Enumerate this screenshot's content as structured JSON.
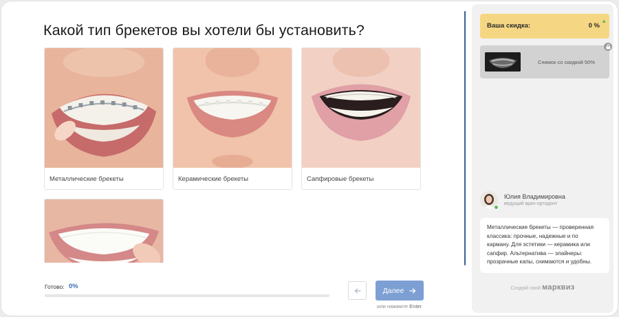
{
  "question": "Какой тип брекетов вы хотели бы установить?",
  "options": [
    {
      "label": "Металлические брекеты"
    },
    {
      "label": "Керамические брекеты"
    },
    {
      "label": "Сапфировые брекеты"
    },
    {
      "label": ""
    }
  ],
  "progress": {
    "label": "Готово:",
    "value": "0%",
    "percent": 0
  },
  "nav": {
    "back_icon": "arrow-left-icon",
    "next_label": "Далее",
    "next_icon": "arrow-right-icon",
    "hint_prefix": "или нажмите",
    "hint_key": "Enter"
  },
  "sidebar": {
    "discount": {
      "label": "Ваша скидка:",
      "value": "0 %"
    },
    "bonus": {
      "text": "Снимок со скидкой 50%",
      "icon": "lock-icon"
    },
    "consultant": {
      "name": "Юлия Владимировна",
      "role": "ведущий врач-ортодонт",
      "message": "Металлические брекеты — проверенная классика: прочные, надежные и по карману. Для эстетики — керамика или сапфир. Альтернатива — элайнеры: прозрачные капы, снимаются и удобны."
    },
    "footer": {
      "prefix": "Создай свой",
      "brand": "марквиз"
    }
  },
  "colors": {
    "accent": "#7d9fd4",
    "discount_bg": "#f5d783",
    "progress_value": "#3c6fb6",
    "online": "#5cb85c"
  }
}
